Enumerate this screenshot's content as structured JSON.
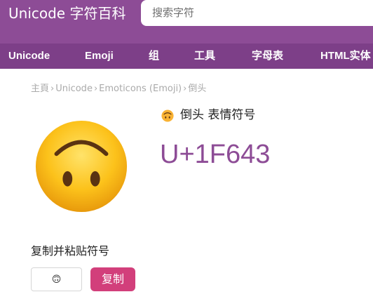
{
  "header": {
    "brand": "Unicode 字符百科",
    "search_placeholder": "搜索字符"
  },
  "nav": {
    "items": [
      {
        "label": "Unicode"
      },
      {
        "label": "Emoji"
      },
      {
        "label": "组"
      },
      {
        "label": "工具"
      },
      {
        "label": "字母表"
      },
      {
        "label": "HTML实体"
      }
    ]
  },
  "breadcrumb": {
    "items": [
      "主頁",
      "Unicode",
      "Emoticons (Emoji)",
      "倒头"
    ],
    "separator": "›"
  },
  "character": {
    "emoji": "🙃",
    "emoji_icon": "upside-down-face-icon",
    "title": "倒头 表情符号",
    "codepoint": "U+1F643"
  },
  "copy": {
    "heading": "复制并粘贴符号",
    "field_value": "🙃",
    "button_label": "复制"
  },
  "colors": {
    "brand_purple": "#8d4c96",
    "nav_purple": "#7d3f88",
    "codepoint_purple": "#8d4c96",
    "copy_button": "#d23f7b"
  }
}
